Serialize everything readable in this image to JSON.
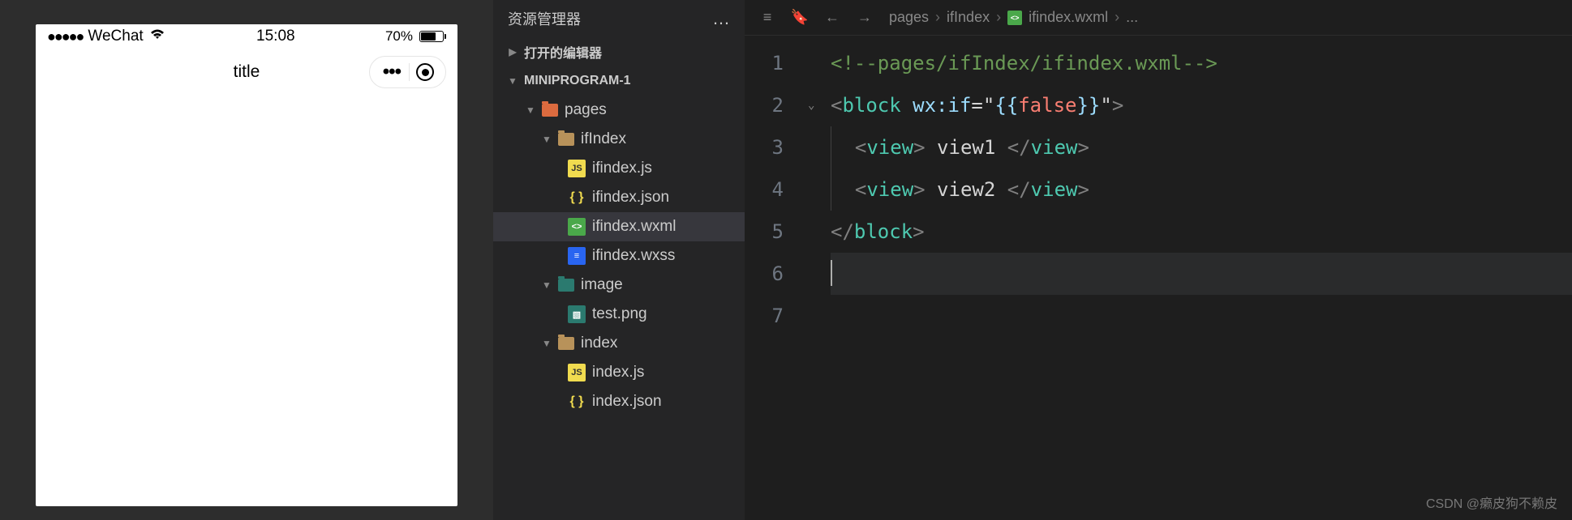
{
  "simulator": {
    "status": {
      "signal": "●●●●●",
      "carrier": "WeChat",
      "time": "15:08",
      "battery": "70%"
    },
    "nav": {
      "title": "title"
    }
  },
  "explorer": {
    "title": "资源管理器",
    "more": "…",
    "sections": {
      "openEditors": "打开的编辑器",
      "project": "MINIPROGRAM-1"
    },
    "tree": {
      "pages": "pages",
      "ifIndex": "ifIndex",
      "files": {
        "ifindex_js": "ifindex.js",
        "ifindex_json": "ifindex.json",
        "ifindex_wxml": "ifindex.wxml",
        "ifindex_wxss": "ifindex.wxss"
      },
      "image": "image",
      "test_png": "test.png",
      "index": "index",
      "index_files": {
        "index_js": "index.js",
        "index_json": "index.json"
      }
    }
  },
  "editor": {
    "breadcrumb": {
      "p1": "pages",
      "p2": "ifIndex",
      "p3": "ifindex.wxml",
      "p4": "..."
    },
    "lines": [
      "1",
      "2",
      "3",
      "4",
      "5",
      "6",
      "7"
    ],
    "code": {
      "l1_comment": "<!--pages/ifIndex/ifindex.wxml-->",
      "l2": {
        "open": "<",
        "tag": "block",
        "attr": " wx:if",
        "eq": "=\"",
        "brace_o": "{{",
        "kw": "false",
        "brace_c": "}}",
        "qclose": "\"",
        "close": ">"
      },
      "l3": {
        "open": "<",
        "tag": "view",
        "close": ">",
        "content": " view1 ",
        "endopen": "</",
        "endtag": "view",
        "endclose": ">"
      },
      "l4": {
        "open": "<",
        "tag": "view",
        "close": ">",
        "content": " view2 ",
        "endopen": "</",
        "endtag": "view",
        "endclose": ">"
      },
      "l5": {
        "open": "</",
        "tag": "block",
        "close": ">"
      }
    }
  },
  "watermark": "CSDN @癞皮狗不赖皮"
}
